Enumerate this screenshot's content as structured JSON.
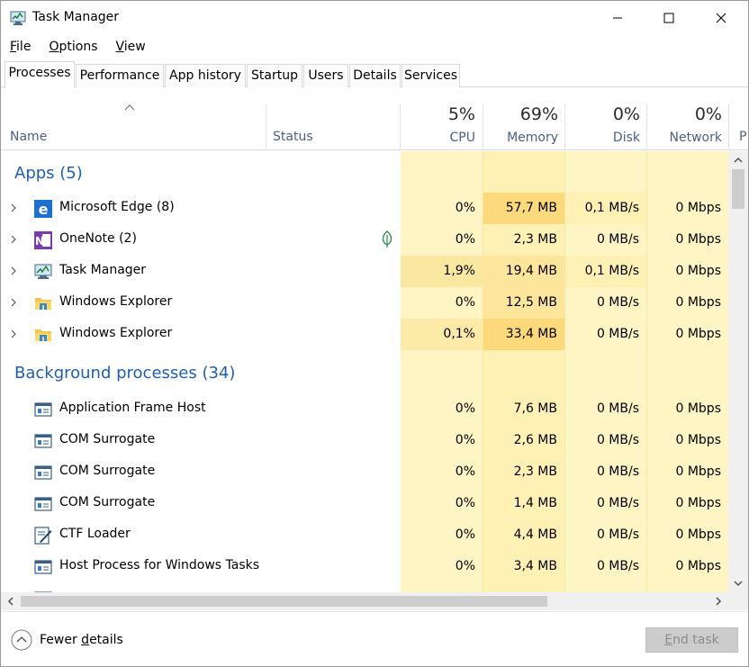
{
  "window": {
    "title": "Task Manager"
  },
  "menu": [
    {
      "accel": "F",
      "rest": "ile"
    },
    {
      "accel": "O",
      "rest": "ptions"
    },
    {
      "accel": "V",
      "rest": "iew"
    }
  ],
  "tabs": [
    "Processes",
    "Performance",
    "App history",
    "Startup",
    "Users",
    "Details",
    "Services"
  ],
  "active_tab": "Processes",
  "header": {
    "name": "Name",
    "status": "Status",
    "cpu_pct": "5%",
    "cpu_label": "CPU",
    "mem_pct": "69%",
    "mem_label": "Memory",
    "disk_pct": "0%",
    "disk_label": "Disk",
    "net_pct": "0%",
    "net_label": "Network",
    "more": "P"
  },
  "groups": {
    "apps": "Apps (5)",
    "background": "Background processes (34)"
  },
  "apps": [
    {
      "name": "Microsoft Edge (8)",
      "cpu": "0%",
      "memory": "57,7 MB",
      "disk": "0,1 MB/s",
      "network": "0 Mbps",
      "icon": "edge-icon"
    },
    {
      "name": "OneNote (2)",
      "cpu": "0%",
      "memory": "2,3 MB",
      "disk": "0 MB/s",
      "network": "0 Mbps",
      "icon": "onenote-icon",
      "status_icon": "leaf-icon"
    },
    {
      "name": "Task Manager",
      "cpu": "1,9%",
      "memory": "19,4 MB",
      "disk": "0,1 MB/s",
      "network": "0 Mbps",
      "icon": "task-manager-icon"
    },
    {
      "name": "Windows Explorer",
      "cpu": "0%",
      "memory": "12,5 MB",
      "disk": "0 MB/s",
      "network": "0 Mbps",
      "icon": "folder-icon"
    },
    {
      "name": "Windows Explorer",
      "cpu": "0,1%",
      "memory": "33,4 MB",
      "disk": "0 MB/s",
      "network": "0 Mbps",
      "icon": "folder-icon"
    }
  ],
  "background": [
    {
      "name": "Application Frame Host",
      "cpu": "0%",
      "memory": "7,6 MB",
      "disk": "0 MB/s",
      "network": "0 Mbps",
      "icon": "window-icon"
    },
    {
      "name": "COM Surrogate",
      "cpu": "0%",
      "memory": "2,6 MB",
      "disk": "0 MB/s",
      "network": "0 Mbps",
      "icon": "window-icon"
    },
    {
      "name": "COM Surrogate",
      "cpu": "0%",
      "memory": "2,3 MB",
      "disk": "0 MB/s",
      "network": "0 Mbps",
      "icon": "window-icon"
    },
    {
      "name": "COM Surrogate",
      "cpu": "0%",
      "memory": "1,4 MB",
      "disk": "0 MB/s",
      "network": "0 Mbps",
      "icon": "window-icon"
    },
    {
      "name": "CTF Loader",
      "cpu": "0%",
      "memory": "4,4 MB",
      "disk": "0 MB/s",
      "network": "0 Mbps",
      "icon": "pen-icon"
    },
    {
      "name": "Host Process for Windows Tasks",
      "cpu": "0%",
      "memory": "3,4 MB",
      "disk": "0 MB/s",
      "network": "0 Mbps",
      "icon": "window-icon"
    }
  ],
  "footer": {
    "fewer_accel_before": "Fewer ",
    "fewer_accel": "d",
    "fewer_accel_after": "etails",
    "end_accel": "E",
    "end_rest": "nd task"
  },
  "colors": {
    "group_title": "#1e5fae",
    "heat_light": "#fff4c4",
    "heat_mid": "#ffefa8",
    "heat_dark": "#f9eca8",
    "header_label": "#4d6082"
  }
}
